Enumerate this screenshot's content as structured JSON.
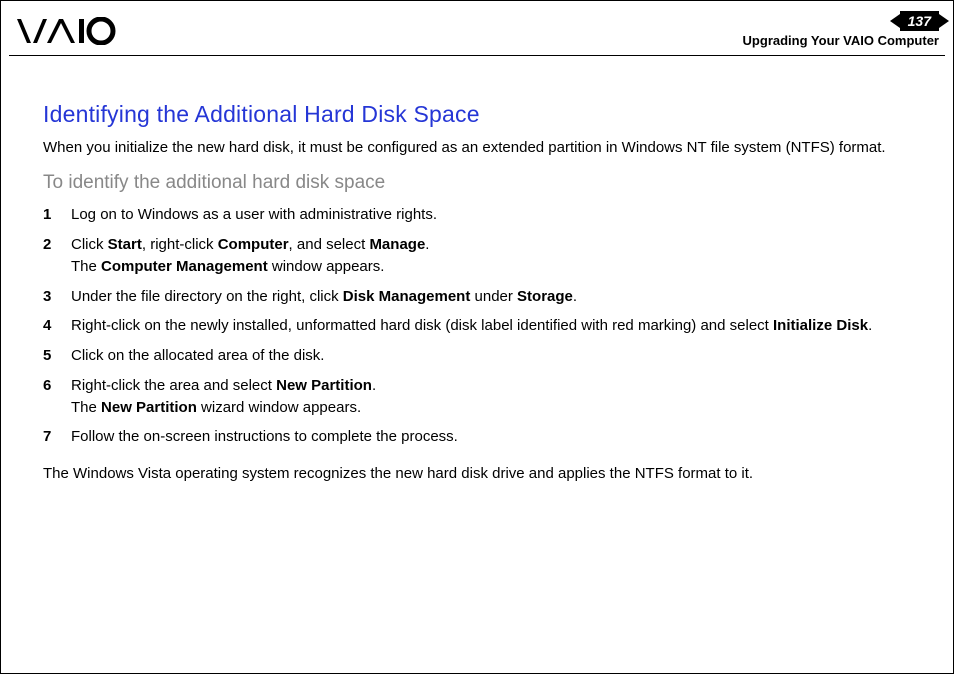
{
  "header": {
    "page_number": "137",
    "section_title": "Upgrading Your VAIO Computer"
  },
  "body": {
    "title": "Identifying the Additional Hard Disk Space",
    "intro": "When you initialize the new hard disk, it must be configured as an extended partition in Windows NT file system (NTFS) format.",
    "subhead": "To identify the additional hard disk space",
    "steps": [
      {
        "n": "1",
        "html": "Log on to Windows as a user with administrative rights."
      },
      {
        "n": "2",
        "html": "Click <b>Start</b>, right-click <b>Computer</b>, and select <b>Manage</b>.<br>The <b>Computer Management</b> window appears."
      },
      {
        "n": "3",
        "html": "Under the file directory on the right, click <b>Disk Management</b> under <b>Storage</b>."
      },
      {
        "n": "4",
        "html": "Right-click on the newly installed, unformatted hard disk (disk label identified with red marking) and select <b>Initialize Disk</b>."
      },
      {
        "n": "5",
        "html": "Click on the allocated area of the disk."
      },
      {
        "n": "6",
        "html": "Right-click the area and select <b>New Partition</b>.<br>The <b>New Partition</b> wizard window appears."
      },
      {
        "n": "7",
        "html": "Follow the on-screen instructions to complete the process."
      }
    ],
    "closing": "The Windows Vista operating system recognizes the new hard disk drive and applies the NTFS format to it."
  }
}
